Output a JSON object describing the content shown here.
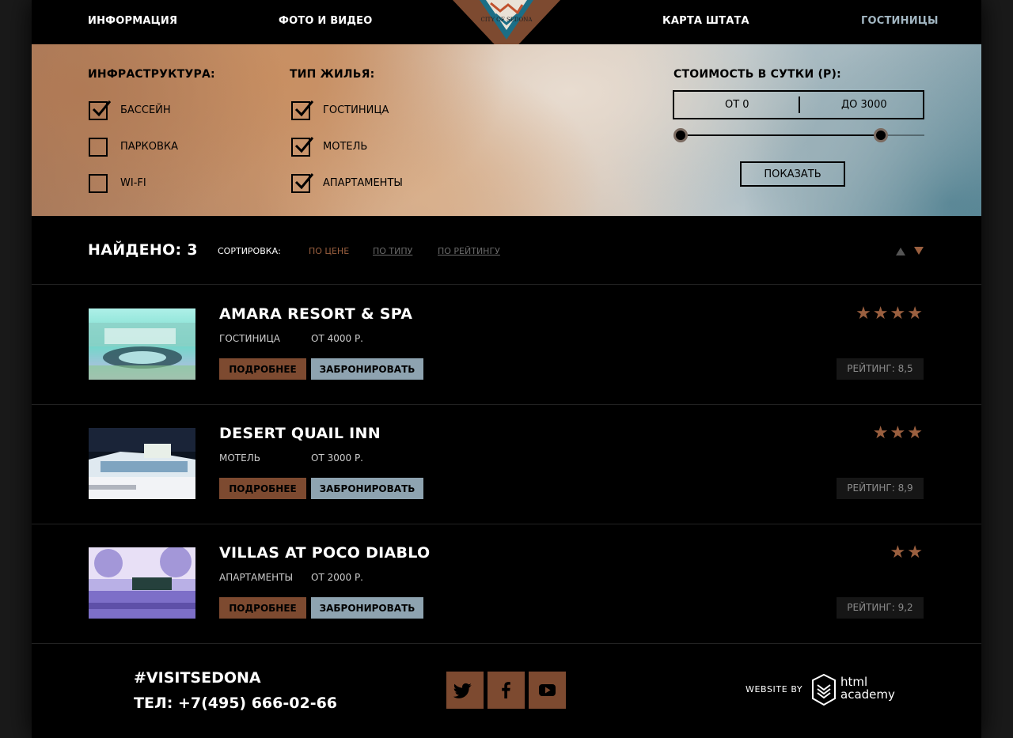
{
  "nav": {
    "items": [
      {
        "label": "ИНФОРМАЦИЯ"
      },
      {
        "label": "ФОТО И ВИДЕО"
      },
      {
        "label": "КАРТА ШТАТА"
      },
      {
        "label": "ГОСТИНИЦЫ"
      }
    ],
    "active_index": 3,
    "logo_text": "CITY OF SEDONA"
  },
  "filter": {
    "infra": {
      "title": "ИНФРАСТРУКТУРА:",
      "options": [
        {
          "label": "БАССЕЙН",
          "checked": true
        },
        {
          "label": "ПАРКОВКА",
          "checked": false
        },
        {
          "label": "WI-FI",
          "checked": false
        }
      ]
    },
    "type": {
      "title": "ТИП ЖИЛЬЯ:",
      "options": [
        {
          "label": "ГОСТИНИЦА",
          "checked": true
        },
        {
          "label": "МОТЕЛЬ",
          "checked": true
        },
        {
          "label": "АПАРТАМЕНТЫ",
          "checked": true
        }
      ]
    },
    "price": {
      "title": "СТОИМОСТЬ В СУТКИ (Р):",
      "from_label": "ОТ 0",
      "to_label": "ДО 3000",
      "range_min_fraction": 0.0,
      "range_max_fraction": 0.82
    },
    "show_button": "ПОКАЗАТЬ"
  },
  "results": {
    "found": "НАЙДЕНО: 3",
    "sort_label": "СОРТИРОВКА:",
    "sort_options": [
      "ПО ЦЕНЕ",
      "ПО ТИПУ",
      "ПО РЕЙТИНГУ"
    ],
    "active_sort": 0
  },
  "hotels": [
    {
      "name": "AMARA RESORT & SPA",
      "type": "ГОСТИНИЦА",
      "price": "ОТ 4000 Р.",
      "stars": 4,
      "rating": "РЕЙТИНГ: 8,5",
      "more": "ПОДРОБНЕЕ",
      "book": "ЗАБРОНИРОВАТЬ"
    },
    {
      "name": "DESERT QUAIL INN",
      "type": "МОТЕЛЬ",
      "price": "ОТ 3000 Р.",
      "stars": 3,
      "rating": "РЕЙТИНГ: 8,9",
      "more": "ПОДРОБНЕЕ",
      "book": "ЗАБРОНИРОВАТЬ"
    },
    {
      "name": "VILLAS AT POCO DIABLO",
      "type": "АПАРТАМЕНТЫ",
      "price": "ОТ 2000 Р.",
      "stars": 2,
      "rating": "РЕЙТИНГ: 9,2",
      "more": "ПОДРОБНЕЕ",
      "book": "ЗАБРОНИРОВАТЬ"
    }
  ],
  "footer": {
    "hashtag": "#VISITSEDONA",
    "phone": "ТЕЛ: +7(495) 666-02-66",
    "socials": [
      "twitter-icon",
      "facebook-icon",
      "youtube-icon"
    ],
    "website_by": "WEBSITE BY",
    "academy_line1": "html",
    "academy_line2": "academy"
  },
  "colors": {
    "accent": "#7d4a30",
    "star": "#9a5f3f",
    "book_button": "#8ea3b0",
    "active_nav": "#a2b6c2"
  }
}
